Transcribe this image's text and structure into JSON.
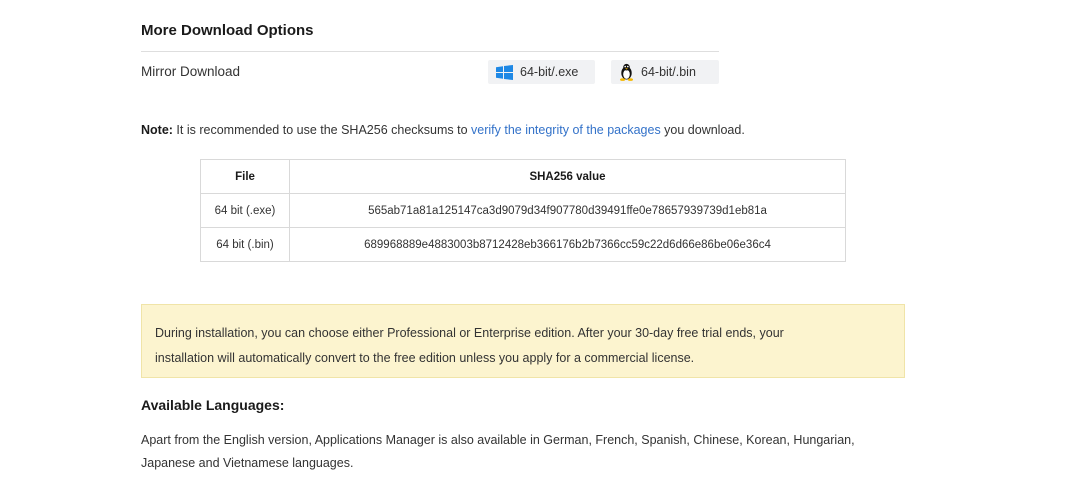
{
  "download_options": {
    "title": "More Download Options",
    "mirror": {
      "label": "Mirror Download",
      "buttons": [
        {
          "label": "64-bit/.exe",
          "icon": "windows-icon",
          "color": "#1e88e5"
        },
        {
          "label": "64-bit/.bin",
          "icon": "linux-tux-icon"
        }
      ]
    }
  },
  "note": {
    "label": "Note:",
    "text_before": " It is recommended to use the SHA256 checksums to ",
    "link_text": "verify the integrity of the packages",
    "text_after": " you download."
  },
  "checksum_table": {
    "headers": [
      "File",
      "SHA256 value"
    ],
    "rows": [
      {
        "file": "64 bit (.exe)",
        "sha": "565ab71a81a125147ca3d9079d34f907780d39491ffe0e78657939739d1eb81a"
      },
      {
        "file": "64 bit (.bin)",
        "sha": "689968889e4883003b8712428eb366176b2b7366cc59c22d6d66e86be06e36c4"
      }
    ]
  },
  "notice": {
    "line1": "During installation, you can choose either Professional or Enterprise edition. After your 30-day free trial ends, your",
    "line2": "installation will automatically convert to the free edition unless you apply for a commercial license."
  },
  "languages": {
    "title": "Available Languages:",
    "line1": "Apart from the English version, Applications Manager is also available in German, French, Spanish, Chinese, Korean, Hungarian,",
    "line2": "Japanese and Vietnamese languages."
  },
  "colors": {
    "link": "#3372c9",
    "notice_bg": "#fcf4cf",
    "button_bg": "#f1f2f4"
  }
}
